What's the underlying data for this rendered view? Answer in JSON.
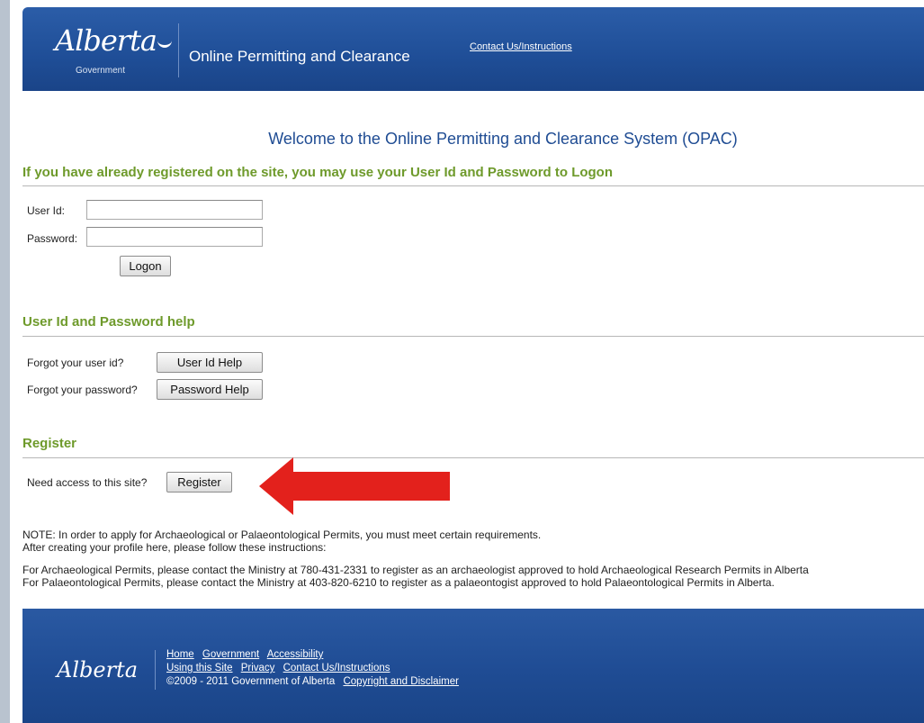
{
  "header": {
    "logo_text": "Alberta",
    "logo_sub": "Government",
    "title": "Online Permitting and Clearance",
    "contact_link": "Contact Us/Instructions"
  },
  "welcome": "Welcome to the Online Permitting and Clearance System (OPAC)",
  "login": {
    "heading": "If you have already registered on the site, you may use your User Id and Password to Logon",
    "user_label": "User Id:",
    "user_value": "",
    "password_label": "Password:",
    "password_value": "",
    "logon_button": "Logon"
  },
  "help": {
    "heading": "User Id and Password help",
    "forgot_user_label": "Forgot your user id?",
    "user_help_button": "User Id Help",
    "forgot_password_label": "Forgot your password?",
    "password_help_button": "Password Help"
  },
  "register": {
    "heading": "Register",
    "need_access_label": "Need access to this site?",
    "register_button": "Register"
  },
  "notes": {
    "line1": "NOTE: In order to apply for Archaeological or Palaeontological Permits, you must meet certain requirements.",
    "line2": "After creating your profile here, please follow these instructions:",
    "line3": "For Archaeological Permits, please contact the Ministry at 780-431-2331 to register as an archaeologist approved to hold Archaeological Research Permits in Alberta",
    "line4": "For Palaeontological Permits, please contact the Ministry at 403-820-6210 to register as a palaeontogist approved to hold Palaeontological Permits in Alberta."
  },
  "footer": {
    "logo_text": "Alberta",
    "links_row1": [
      "Home",
      "Government",
      "Accessibility"
    ],
    "links_row2": [
      "Using this Site",
      "Privacy",
      "Contact Us/Instructions"
    ],
    "copyright": "©2009 - 2011 Government of Alberta",
    "copyright_link": "Copyright and Disclaimer"
  },
  "colors": {
    "header_blue": "#1f4e97",
    "heading_green": "#6e9a2b",
    "welcome_blue": "#1f4c93",
    "arrow_red": "#e3211c"
  },
  "icons": {
    "annotation_arrow": "red-arrow-left-icon"
  }
}
